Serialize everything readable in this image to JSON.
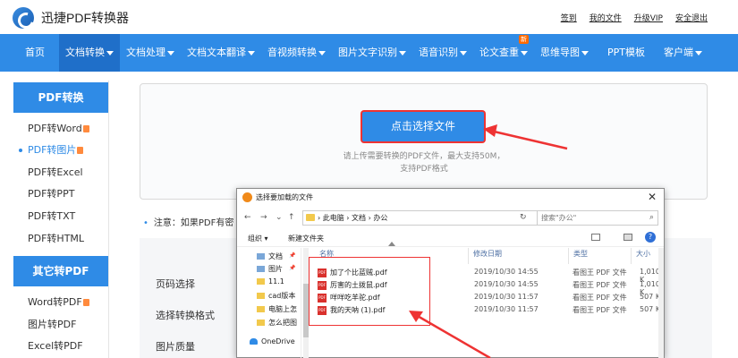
{
  "header": {
    "logo_text": "迅捷PDF转换器",
    "links": {
      "signin": "签到",
      "my_files": "我的文件",
      "upgrade": "升级VIP",
      "logout": "安全退出"
    }
  },
  "nav": {
    "items": [
      {
        "label": "首页",
        "dropdown": false
      },
      {
        "label": "文档转换",
        "dropdown": true,
        "active": true
      },
      {
        "label": "文档处理",
        "dropdown": true
      },
      {
        "label": "文档文本翻译",
        "dropdown": true
      },
      {
        "label": "音视频转换",
        "dropdown": true
      },
      {
        "label": "图片文字识别",
        "dropdown": true
      },
      {
        "label": "语音识别",
        "dropdown": true
      },
      {
        "label": "论文查重",
        "dropdown": true,
        "badge": "新"
      },
      {
        "label": "思维导图",
        "dropdown": true
      },
      {
        "label": "PPT模板",
        "dropdown": false
      },
      {
        "label": "客户端",
        "dropdown": true
      }
    ]
  },
  "sidebar": {
    "section1_title": "PDF转换",
    "section1_items": [
      {
        "label": "PDF转Word",
        "hot": true
      },
      {
        "label": "PDF转图片",
        "hot": true,
        "active": true
      },
      {
        "label": "PDF转Excel"
      },
      {
        "label": "PDF转PPT"
      },
      {
        "label": "PDF转TXT"
      },
      {
        "label": "PDF转HTML"
      }
    ],
    "section2_title": "其它转PDF",
    "section2_items": [
      {
        "label": "Word转PDF",
        "hot": true
      },
      {
        "label": "图片转PDF"
      },
      {
        "label": "Excel转PDF"
      }
    ]
  },
  "main": {
    "upload_button": "点击选择文件",
    "upload_hint_1": "请上传需要转换的PDF文件，最大支持50M，",
    "upload_hint_2": "支持PDF格式",
    "note": "注意：如果PDF有密",
    "settings": {
      "page_select": "页码选择",
      "convert_format": "选择转换格式",
      "image_quality": "图片质量"
    }
  },
  "dialog": {
    "title": "选择要加载的文件",
    "breadcrumb": {
      "root": "此电脑",
      "docs": "文档",
      "folder": "办公"
    },
    "search_placeholder": "搜索\"办公\"",
    "toolbar": {
      "organize": "组织 ▾",
      "new_folder": "新建文件夹"
    },
    "tree": [
      {
        "label": "文档",
        "pinned": true,
        "icon": "pc"
      },
      {
        "label": "图片",
        "pinned": true,
        "icon": "pc"
      },
      {
        "label": "11.1",
        "icon": "folder"
      },
      {
        "label": "cad版本",
        "icon": "folder"
      },
      {
        "label": "电脑上怎",
        "icon": "folder"
      },
      {
        "label": "怎么把图",
        "icon": "folder"
      },
      {
        "label": "OneDrive",
        "icon": "onedrive"
      }
    ],
    "columns": {
      "name": "名称",
      "date": "修改日期",
      "type": "类型",
      "size": "大小"
    },
    "files": [
      {
        "name": "加了个比蓝贼.pdf",
        "date": "2019/10/30 14:55",
        "type": "看图王 PDF 文件",
        "size": "1,010 K"
      },
      {
        "name": "厉害的土拨鼠.pdf",
        "date": "2019/10/30 14:55",
        "type": "看图王 PDF 文件",
        "size": "1,010 K"
      },
      {
        "name": "咩咩吃羊驼.pdf",
        "date": "2019/10/30 11:57",
        "type": "看图王 PDF 文件",
        "size": "507 K"
      },
      {
        "name": "我的天呐 (1).pdf",
        "date": "2019/10/30 11:57",
        "type": "看图王 PDF 文件",
        "size": "507 K"
      }
    ],
    "pdf_tag": "PDF"
  },
  "colors": {
    "brand_blue": "#2f8be6",
    "annotation_red": "#e33333",
    "hot_orange": "#ff8a3d"
  }
}
